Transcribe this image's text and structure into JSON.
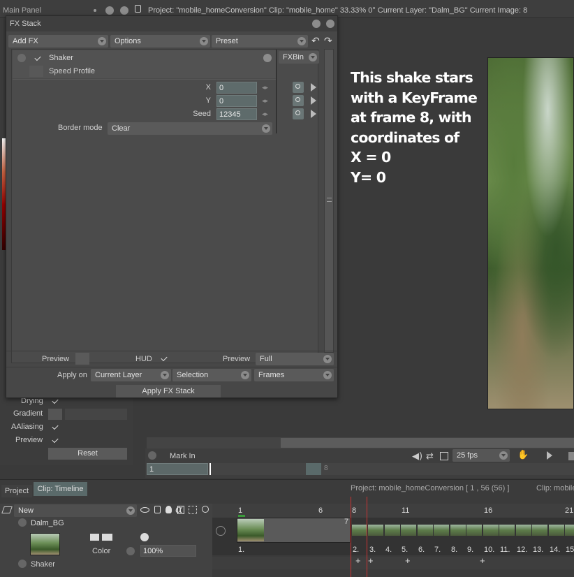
{
  "main_panel": {
    "title": "Main Panel",
    "status": "Project: \"mobile_homeConversion\"  Clip: \"mobile_home\"   33.33%   0°  Current Layer: \"Dalm_BG\"  Current Image: 8"
  },
  "fx_stack": {
    "title": "FX Stack",
    "toolbar": {
      "add_fx": "Add FX",
      "options": "Options",
      "preset": "Preset"
    },
    "effect": {
      "name": "Shaker",
      "speed_profile": "Speed Profile",
      "fxbin": "FXBin"
    },
    "params": [
      {
        "label": "X",
        "value": "0"
      },
      {
        "label": "Y",
        "value": "0"
      },
      {
        "label": "Seed",
        "value": "12345"
      }
    ],
    "border_mode": {
      "label": "Border mode",
      "value": "Clear"
    },
    "bottom": {
      "preview_label": "Preview",
      "hud_label": "HUD",
      "preview2_label": "Preview",
      "preview2_value": "Full",
      "apply_on_label": "Apply on",
      "apply_on_value": "Current Layer",
      "selection_value": "Selection",
      "frames_value": "Frames",
      "apply_button": "Apply FX Stack"
    }
  },
  "annotation": {
    "lines": [
      "This shake stars",
      "with a KeyFrame",
      "at frame 8, with",
      "coordinates of",
      "X = 0",
      "Y= 0"
    ]
  },
  "left_panel": {
    "drying": "Drying",
    "gradient": "Gradient",
    "aaliasing": "AAliasing",
    "preview": "Preview",
    "reset": "Reset"
  },
  "transport": {
    "mark_in": "Mark In",
    "fps": "25 fps",
    "frame_field": "1",
    "frame_marker": "8"
  },
  "timeline": {
    "tabs": [
      "Project",
      "Clip: Timeline"
    ],
    "project_info": "Project: mobile_homeConversion [ 1 , 56  (56) ]",
    "clip_label": "Clip: mobile",
    "new_label": "New",
    "layer_name": "Dalm_BG",
    "color_label": "Color",
    "opacity": "100%",
    "shaker_label": "Shaker",
    "ruler": [
      "1",
      "6",
      "8",
      "11",
      "16",
      "21"
    ],
    "frame_7": "7",
    "frame_labels": [
      "1.",
      "2.",
      "3.",
      "4.",
      "5.",
      "6.",
      "7.",
      "8.",
      "9.",
      "10.",
      "11.",
      "12.",
      "13.",
      "14.",
      "15."
    ]
  }
}
